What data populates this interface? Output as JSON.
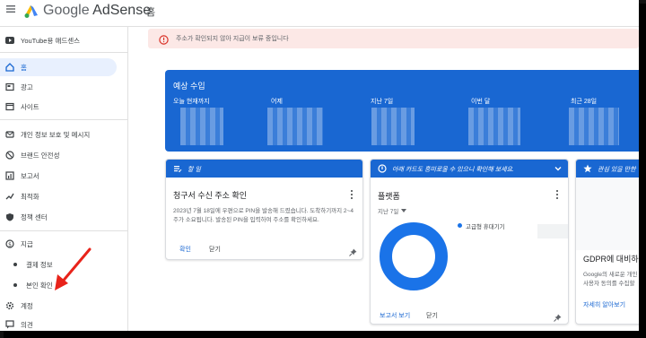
{
  "app": {
    "brand_google": "Google",
    "brand_product": "AdSense",
    "crumb": "홈"
  },
  "sidebar": {
    "account": "YouTube용 애드센스",
    "items": [
      {
        "label": "홈",
        "icon": "home-icon"
      },
      {
        "label": "광고",
        "icon": "ads-icon"
      },
      {
        "label": "사이트",
        "icon": "sites-icon"
      },
      {
        "label": "개인 정보 보호 및 메시지",
        "icon": "privacy-icon"
      },
      {
        "label": "브랜드 안전성",
        "icon": "brand-safety-icon"
      },
      {
        "label": "보고서",
        "icon": "reports-icon"
      },
      {
        "label": "최적화",
        "icon": "optimization-icon"
      },
      {
        "label": "정책 센터",
        "icon": "policy-icon"
      },
      {
        "label": "지급",
        "icon": "payments-icon"
      },
      {
        "label": "결제 정보"
      },
      {
        "label": "본인 확인"
      },
      {
        "label": "계정",
        "icon": "settings-icon"
      },
      {
        "label": "의견",
        "icon": "feedback-icon"
      }
    ]
  },
  "alert": {
    "text": "주소가 확인되지 않아 지급이 보류 중입니다"
  },
  "earnings": {
    "title": "예상 수입",
    "columns": [
      "오늘 현재까지",
      "어제",
      "지난 7일",
      "이번 달",
      "최근 28일"
    ]
  },
  "todo": {
    "header": "할 일",
    "title": "청구서 수신 주소 확인",
    "body": "2023년 7월 18일에 우편으로 PIN을 발송해 드렸습니다. 도착하기까지 2~4주가 소요됩니다. 발송된 PIN을 입력하여 주소를 확인하세요.",
    "primary": "확인",
    "secondary": "닫기"
  },
  "platform": {
    "header": "아래 카드도 흥미로울 수 있으니 확인해 보세요.",
    "title": "플랫폼",
    "range": "지난 7일",
    "legend": "고급형 휴대기기",
    "primary": "보고서 보기",
    "secondary": "닫기"
  },
  "interest": {
    "header": "관심 있을 만한",
    "title": "GDPR에 대비하",
    "body": "Google의 새로운 개인 사용자 동의를 수집할",
    "link": "자세히 알아보기"
  },
  "colors": {
    "primary": "#1967d2",
    "alert_bg": "#fce8e6",
    "donut": "#1a73e8",
    "annotation": "#e8231a"
  }
}
